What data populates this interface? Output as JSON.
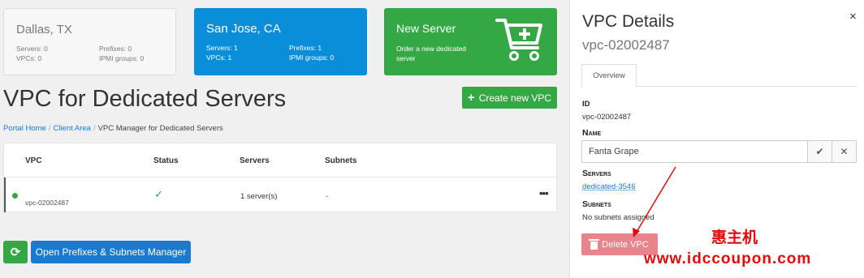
{
  "summary_cards": {
    "dallas": {
      "city": "Dallas, TX",
      "servers": "Servers: 0",
      "prefixes": "Prefixes: 0",
      "vpcs": "VPCs: 0",
      "ipmi": "IPMI groups: 0"
    },
    "sanjose": {
      "city": "San Jose, CA",
      "servers": "Servers: 1",
      "prefixes": "Prefixes: 1",
      "vpcs": "VPCs: 1",
      "ipmi": "IPMI groups: 0"
    },
    "new_server": {
      "title": "New Server",
      "desc": "Order a new dedicated server"
    }
  },
  "page": {
    "title": "VPC for Dedicated Servers",
    "create_button": "Create new VPC"
  },
  "breadcrumb": {
    "home": "Portal Home",
    "client": "Client Area",
    "current": "VPC Manager for Dedicated Servers"
  },
  "table": {
    "headers": [
      "VPC",
      "Status",
      "Servers",
      "Subnets"
    ],
    "rows": [
      {
        "vpc": "vpc-02002487",
        "servers": "1 server(s)",
        "subnets": "-",
        "more": "•••"
      }
    ]
  },
  "bottom": {
    "prefixes_button": "Open Prefixes & Subnets Manager"
  },
  "panel": {
    "title": "VPC Details",
    "subtitle": "vpc-02002487",
    "tab": "Overview",
    "id_label": "ID",
    "id_value": "vpc-02002487",
    "name_label": "Name",
    "name_value": "Fanta Grape",
    "servers_label": "Servers",
    "server_link": "dedicated-3546",
    "subnets_label": "Subnets",
    "subnets_value": "No subnets assigned",
    "delete_button": "Delete VPC",
    "close": "×"
  },
  "watermark": {
    "cn": "惠主机",
    "url": "www.idccoupon.com"
  },
  "colors": {
    "green": "#35a846",
    "blue": "#0a8ed9",
    "link": "#1a7ad0",
    "danger": "#e8848c",
    "watermark": "#e30c0c"
  }
}
